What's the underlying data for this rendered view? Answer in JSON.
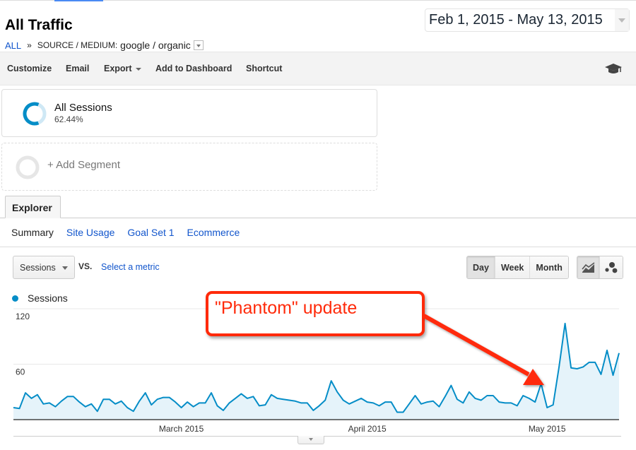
{
  "header": {
    "title": "All Traffic",
    "breadcrumb": {
      "root": "ALL",
      "separator": "»",
      "dimension_label": "SOURCE / MEDIUM:",
      "dimension_value": "google / organic"
    },
    "date_range": "Feb 1, 2015 - May 13, 2015"
  },
  "toolbar": {
    "customize": "Customize",
    "email": "Email",
    "export": "Export",
    "add_to_dashboard": "Add to Dashboard",
    "shortcut": "Shortcut",
    "icons": {
      "help": "graduation-cap-icon"
    }
  },
  "segments": {
    "active": {
      "name": "All Sessions",
      "percent": "62.44%",
      "share": 0.6244
    },
    "add_label": "+ Add Segment"
  },
  "tabs": {
    "explorer": "Explorer",
    "subtabs": [
      {
        "label": "Summary",
        "active": true
      },
      {
        "label": "Site Usage",
        "active": false
      },
      {
        "label": "Goal Set 1",
        "active": false
      },
      {
        "label": "Ecommerce",
        "active": false
      }
    ]
  },
  "controls": {
    "metric": "Sessions",
    "vs": "VS.",
    "select_metric": "Select a metric",
    "granularity": [
      {
        "label": "Day",
        "active": true
      },
      {
        "label": "Week",
        "active": false
      },
      {
        "label": "Month",
        "active": false
      }
    ],
    "chart_types": [
      {
        "icon": "line-chart-icon",
        "active": true
      },
      {
        "icon": "motion-chart-icon",
        "active": false
      }
    ]
  },
  "annotation": {
    "text": "\"Phantom\" update",
    "color": "#ff2a0a",
    "points_to_date": "2015-04-30"
  },
  "colors": {
    "series": "#058dc7",
    "area": "#e5f3fa",
    "link": "#1155cc"
  },
  "chart_data": {
    "type": "area",
    "title": "",
    "legend": [
      {
        "name": "Sessions",
        "color": "#058dc7"
      }
    ],
    "legend_position": "top-left",
    "x_start": "2015-02-01",
    "x_end": "2015-05-13",
    "x_tick_labels": [
      {
        "label": "March 2015",
        "day_index": 28
      },
      {
        "label": "April 2015",
        "day_index": 59
      },
      {
        "label": "May 2015",
        "day_index": 89
      }
    ],
    "y_ticks": [
      60,
      120
    ],
    "ylim": [
      0,
      120
    ],
    "grid": true,
    "series": [
      {
        "name": "Sessions",
        "values": [
          13,
          12,
          29,
          23,
          27,
          17,
          18,
          14,
          20,
          25,
          25,
          19,
          14,
          17,
          9,
          22,
          22,
          17,
          20,
          13,
          9,
          20,
          29,
          16,
          22,
          24,
          24,
          19,
          13,
          19,
          14,
          18,
          18,
          29,
          15,
          10,
          18,
          23,
          28,
          23,
          25,
          15,
          16,
          27,
          23,
          22,
          21,
          20,
          18,
          18,
          10,
          15,
          21,
          42,
          30,
          21,
          17,
          20,
          23,
          19,
          18,
          15,
          19,
          19,
          8,
          8,
          17,
          26,
          17,
          19,
          20,
          14,
          25,
          37,
          22,
          18,
          30,
          23,
          21,
          26,
          26,
          19,
          18,
          18,
          15,
          26,
          23,
          19,
          39,
          13,
          16,
          57,
          104,
          56,
          55,
          57,
          62,
          62,
          49,
          75,
          48,
          72
        ]
      }
    ]
  }
}
